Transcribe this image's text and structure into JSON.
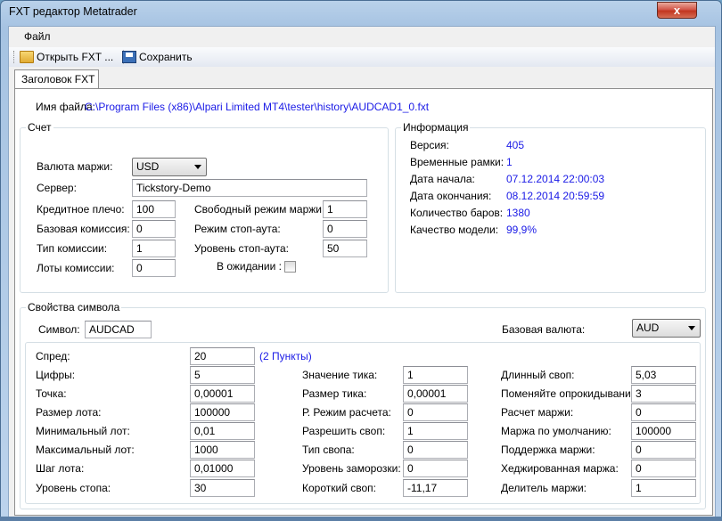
{
  "window": {
    "title": "FXT редактор Metatrader",
    "close_glyph": "x"
  },
  "menu": {
    "file": "Файл"
  },
  "toolbar": {
    "open": "Открыть FXT ...",
    "save": "Сохранить"
  },
  "tab": {
    "label": "Заголовок FXT"
  },
  "file": {
    "label": "Имя файла:",
    "path": "C:\\Program Files (x86)\\Alpari Limited MT4\\tester\\history\\AUDCAD1_0.fxt"
  },
  "account": {
    "title": "Счет",
    "margin_currency": {
      "label": "Валюта маржи:",
      "value": "USD"
    },
    "server": {
      "label": "Сервер:",
      "value": "Tickstory-Demo"
    },
    "leverage": {
      "label": "Кредитное плечо:",
      "value": "100"
    },
    "free_margin_mode": {
      "label": "Свободный режим маржи:",
      "value": "1"
    },
    "base_commission": {
      "label": "Базовая комиссия:",
      "value": "0"
    },
    "stopout_mode": {
      "label": "Режим стоп-аута:",
      "value": "0"
    },
    "commission_type": {
      "label": "Тип комиссии:",
      "value": "1"
    },
    "stopout_level": {
      "label": "Уровень стоп-аута:",
      "value": "50"
    },
    "commission_lots": {
      "label": "Лоты комиссии:",
      "value": "0"
    },
    "pending": {
      "label": "В ожидании :",
      "checked": false
    }
  },
  "info": {
    "title": "Информация",
    "version": {
      "label": "Версия:",
      "value": "405"
    },
    "timeframe": {
      "label": "Временные рамки:",
      "value": "1"
    },
    "start": {
      "label": "Дата начала:",
      "value": "07.12.2014 22:00:03"
    },
    "end": {
      "label": "Дата окончания:",
      "value": "08.12.2014 20:59:59"
    },
    "bars": {
      "label": "Количество баров:",
      "value": "1380"
    },
    "quality": {
      "label": "Качество модели:",
      "value": "99,9%"
    }
  },
  "symbol": {
    "title": "Свойства символа",
    "symbol": {
      "label": "Символ:",
      "value": "AUDCAD"
    },
    "base_currency": {
      "label": "Базовая валюта:",
      "value": "AUD"
    },
    "spread": {
      "label": "Спред:",
      "value": "20",
      "note": "(2 Пункты)"
    },
    "digits": {
      "label": "Цифры:",
      "value": "5"
    },
    "point": {
      "label": "Точка:",
      "value": "0,00001"
    },
    "lot_size": {
      "label": "Размер лота:",
      "value": "100000"
    },
    "min_lot": {
      "label": "Минимальный лот:",
      "value": "0,01"
    },
    "max_lot": {
      "label": "Максимальный лот:",
      "value": "1000"
    },
    "lot_step": {
      "label": "Шаг лота:",
      "value": "0,01000"
    },
    "stop_level": {
      "label": "Уровень стопа:",
      "value": "30"
    },
    "tick_value": {
      "label": "Значение тика:",
      "value": "1"
    },
    "tick_size": {
      "label": "Размер тика:",
      "value": "0,00001"
    },
    "calc_mode": {
      "label": "Р. Режим расчета:",
      "value": "0"
    },
    "swap_enable": {
      "label": "Разрешить своп:",
      "value": "1"
    },
    "swap_type": {
      "label": "Тип свопа:",
      "value": "0"
    },
    "freeze_level": {
      "label": "Уровень заморозки:",
      "value": "0"
    },
    "swap_short": {
      "label": "Короткий своп:",
      "value": "-11,17"
    },
    "swap_long": {
      "label": "Длинный своп:",
      "value": "5,03"
    },
    "rollover": {
      "label": "Поменяйте опрокидывание:",
      "value": "3"
    },
    "margin_calc": {
      "label": "Расчет маржи:",
      "value": "0"
    },
    "margin_default": {
      "label": "Маржа по умолчанию:",
      "value": "100000"
    },
    "margin_maintenance": {
      "label": "Поддержка маржи:",
      "value": "0"
    },
    "margin_hedged": {
      "label": "Хеджированная маржа:",
      "value": "0"
    },
    "margin_divider": {
      "label": "Делитель маржи:",
      "value": "1"
    }
  }
}
